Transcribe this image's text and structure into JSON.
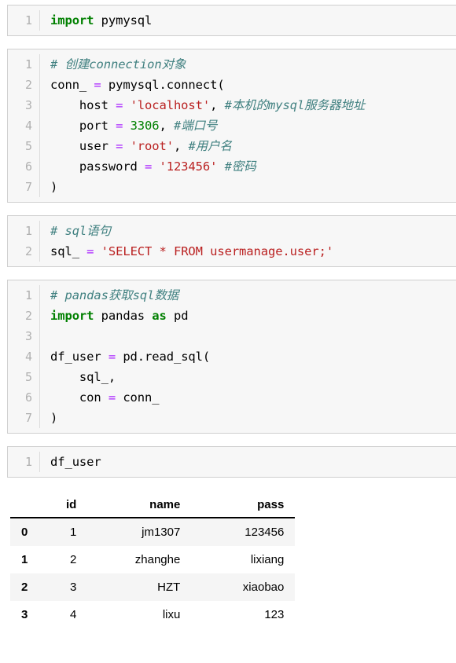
{
  "notebook": {
    "cells": [
      {
        "name": "cell-import-pymysql",
        "line_numbers": [
          "1"
        ],
        "lines": [
          [
            {
              "t": "k",
              "v": "import"
            },
            {
              "t": "p",
              "v": " "
            },
            {
              "t": "n",
              "v": "pymysql"
            }
          ]
        ]
      },
      {
        "name": "cell-create-connection",
        "line_numbers": [
          "1",
          "2",
          "3",
          "4",
          "5",
          "6",
          "7"
        ],
        "lines": [
          [
            {
              "t": "c",
              "v": "# 创建connection对象"
            }
          ],
          [
            {
              "t": "n",
              "v": "conn_ "
            },
            {
              "t": "o",
              "v": "="
            },
            {
              "t": "n",
              "v": " pymysql"
            },
            {
              "t": "p",
              "v": "."
            },
            {
              "t": "n",
              "v": "connect"
            },
            {
              "t": "p",
              "v": "("
            }
          ],
          [
            {
              "t": "n",
              "v": "    host "
            },
            {
              "t": "o",
              "v": "="
            },
            {
              "t": "p",
              "v": " "
            },
            {
              "t": "s",
              "v": "'localhost'"
            },
            {
              "t": "p",
              "v": ", "
            },
            {
              "t": "c",
              "v": "#本机的mysql服务器地址"
            }
          ],
          [
            {
              "t": "n",
              "v": "    port "
            },
            {
              "t": "o",
              "v": "="
            },
            {
              "t": "p",
              "v": " "
            },
            {
              "t": "m",
              "v": "3306"
            },
            {
              "t": "p",
              "v": ", "
            },
            {
              "t": "c",
              "v": "#端口号"
            }
          ],
          [
            {
              "t": "n",
              "v": "    user "
            },
            {
              "t": "o",
              "v": "="
            },
            {
              "t": "p",
              "v": " "
            },
            {
              "t": "s",
              "v": "'root'"
            },
            {
              "t": "p",
              "v": ", "
            },
            {
              "t": "c",
              "v": "#用户名"
            }
          ],
          [
            {
              "t": "n",
              "v": "    password "
            },
            {
              "t": "o",
              "v": "="
            },
            {
              "t": "p",
              "v": " "
            },
            {
              "t": "s",
              "v": "'123456'"
            },
            {
              "t": "p",
              "v": " "
            },
            {
              "t": "c",
              "v": "#密码"
            }
          ],
          [
            {
              "t": "p",
              "v": ")"
            }
          ]
        ]
      },
      {
        "name": "cell-sql-statement",
        "line_numbers": [
          "1",
          "2"
        ],
        "lines": [
          [
            {
              "t": "c",
              "v": "# sql语句"
            }
          ],
          [
            {
              "t": "n",
              "v": "sql_ "
            },
            {
              "t": "o",
              "v": "="
            },
            {
              "t": "p",
              "v": " "
            },
            {
              "t": "s",
              "v": "'SELECT * FROM usermanage.user;'"
            }
          ]
        ]
      },
      {
        "name": "cell-pandas-read-sql",
        "line_numbers": [
          "1",
          "2",
          "3",
          "4",
          "5",
          "6",
          "7"
        ],
        "lines": [
          [
            {
              "t": "c",
              "v": "# pandas获取sql数据"
            }
          ],
          [
            {
              "t": "k",
              "v": "import"
            },
            {
              "t": "n",
              "v": " pandas "
            },
            {
              "t": "k",
              "v": "as"
            },
            {
              "t": "n",
              "v": " pd"
            }
          ],
          [
            {
              "t": "p",
              "v": ""
            }
          ],
          [
            {
              "t": "n",
              "v": "df_user "
            },
            {
              "t": "o",
              "v": "="
            },
            {
              "t": "n",
              "v": " pd"
            },
            {
              "t": "p",
              "v": "."
            },
            {
              "t": "n",
              "v": "read_sql"
            },
            {
              "t": "p",
              "v": "("
            }
          ],
          [
            {
              "t": "n",
              "v": "    sql_"
            },
            {
              "t": "p",
              "v": ","
            }
          ],
          [
            {
              "t": "n",
              "v": "    con "
            },
            {
              "t": "o",
              "v": "="
            },
            {
              "t": "n",
              "v": " conn_"
            }
          ],
          [
            {
              "t": "p",
              "v": ")"
            }
          ]
        ]
      },
      {
        "name": "cell-show-dataframe",
        "line_numbers": [
          "1"
        ],
        "lines": [
          [
            {
              "t": "n",
              "v": "df_user"
            }
          ]
        ]
      }
    ]
  },
  "dataframe_output": {
    "index_header": "",
    "columns": [
      "id",
      "name",
      "pass"
    ],
    "index": [
      "0",
      "1",
      "2",
      "3"
    ],
    "rows": [
      [
        "1",
        "jm1307",
        "123456"
      ],
      [
        "2",
        "zhanghe",
        "lixiang"
      ],
      [
        "3",
        "HZT",
        "xiaobao"
      ],
      [
        "4",
        "lixu",
        "123"
      ]
    ]
  },
  "theme": {
    "cell_background": "#f7f7f7",
    "cell_border": "#cfcfcf",
    "gutter_text": "#b0b0b0",
    "keyword_color": "#008000",
    "string_color": "#ba2121",
    "comment_color": "#408080",
    "number_color": "#008000",
    "operator_color": "#aa22ff",
    "table_stripe": "#f5f5f5"
  }
}
